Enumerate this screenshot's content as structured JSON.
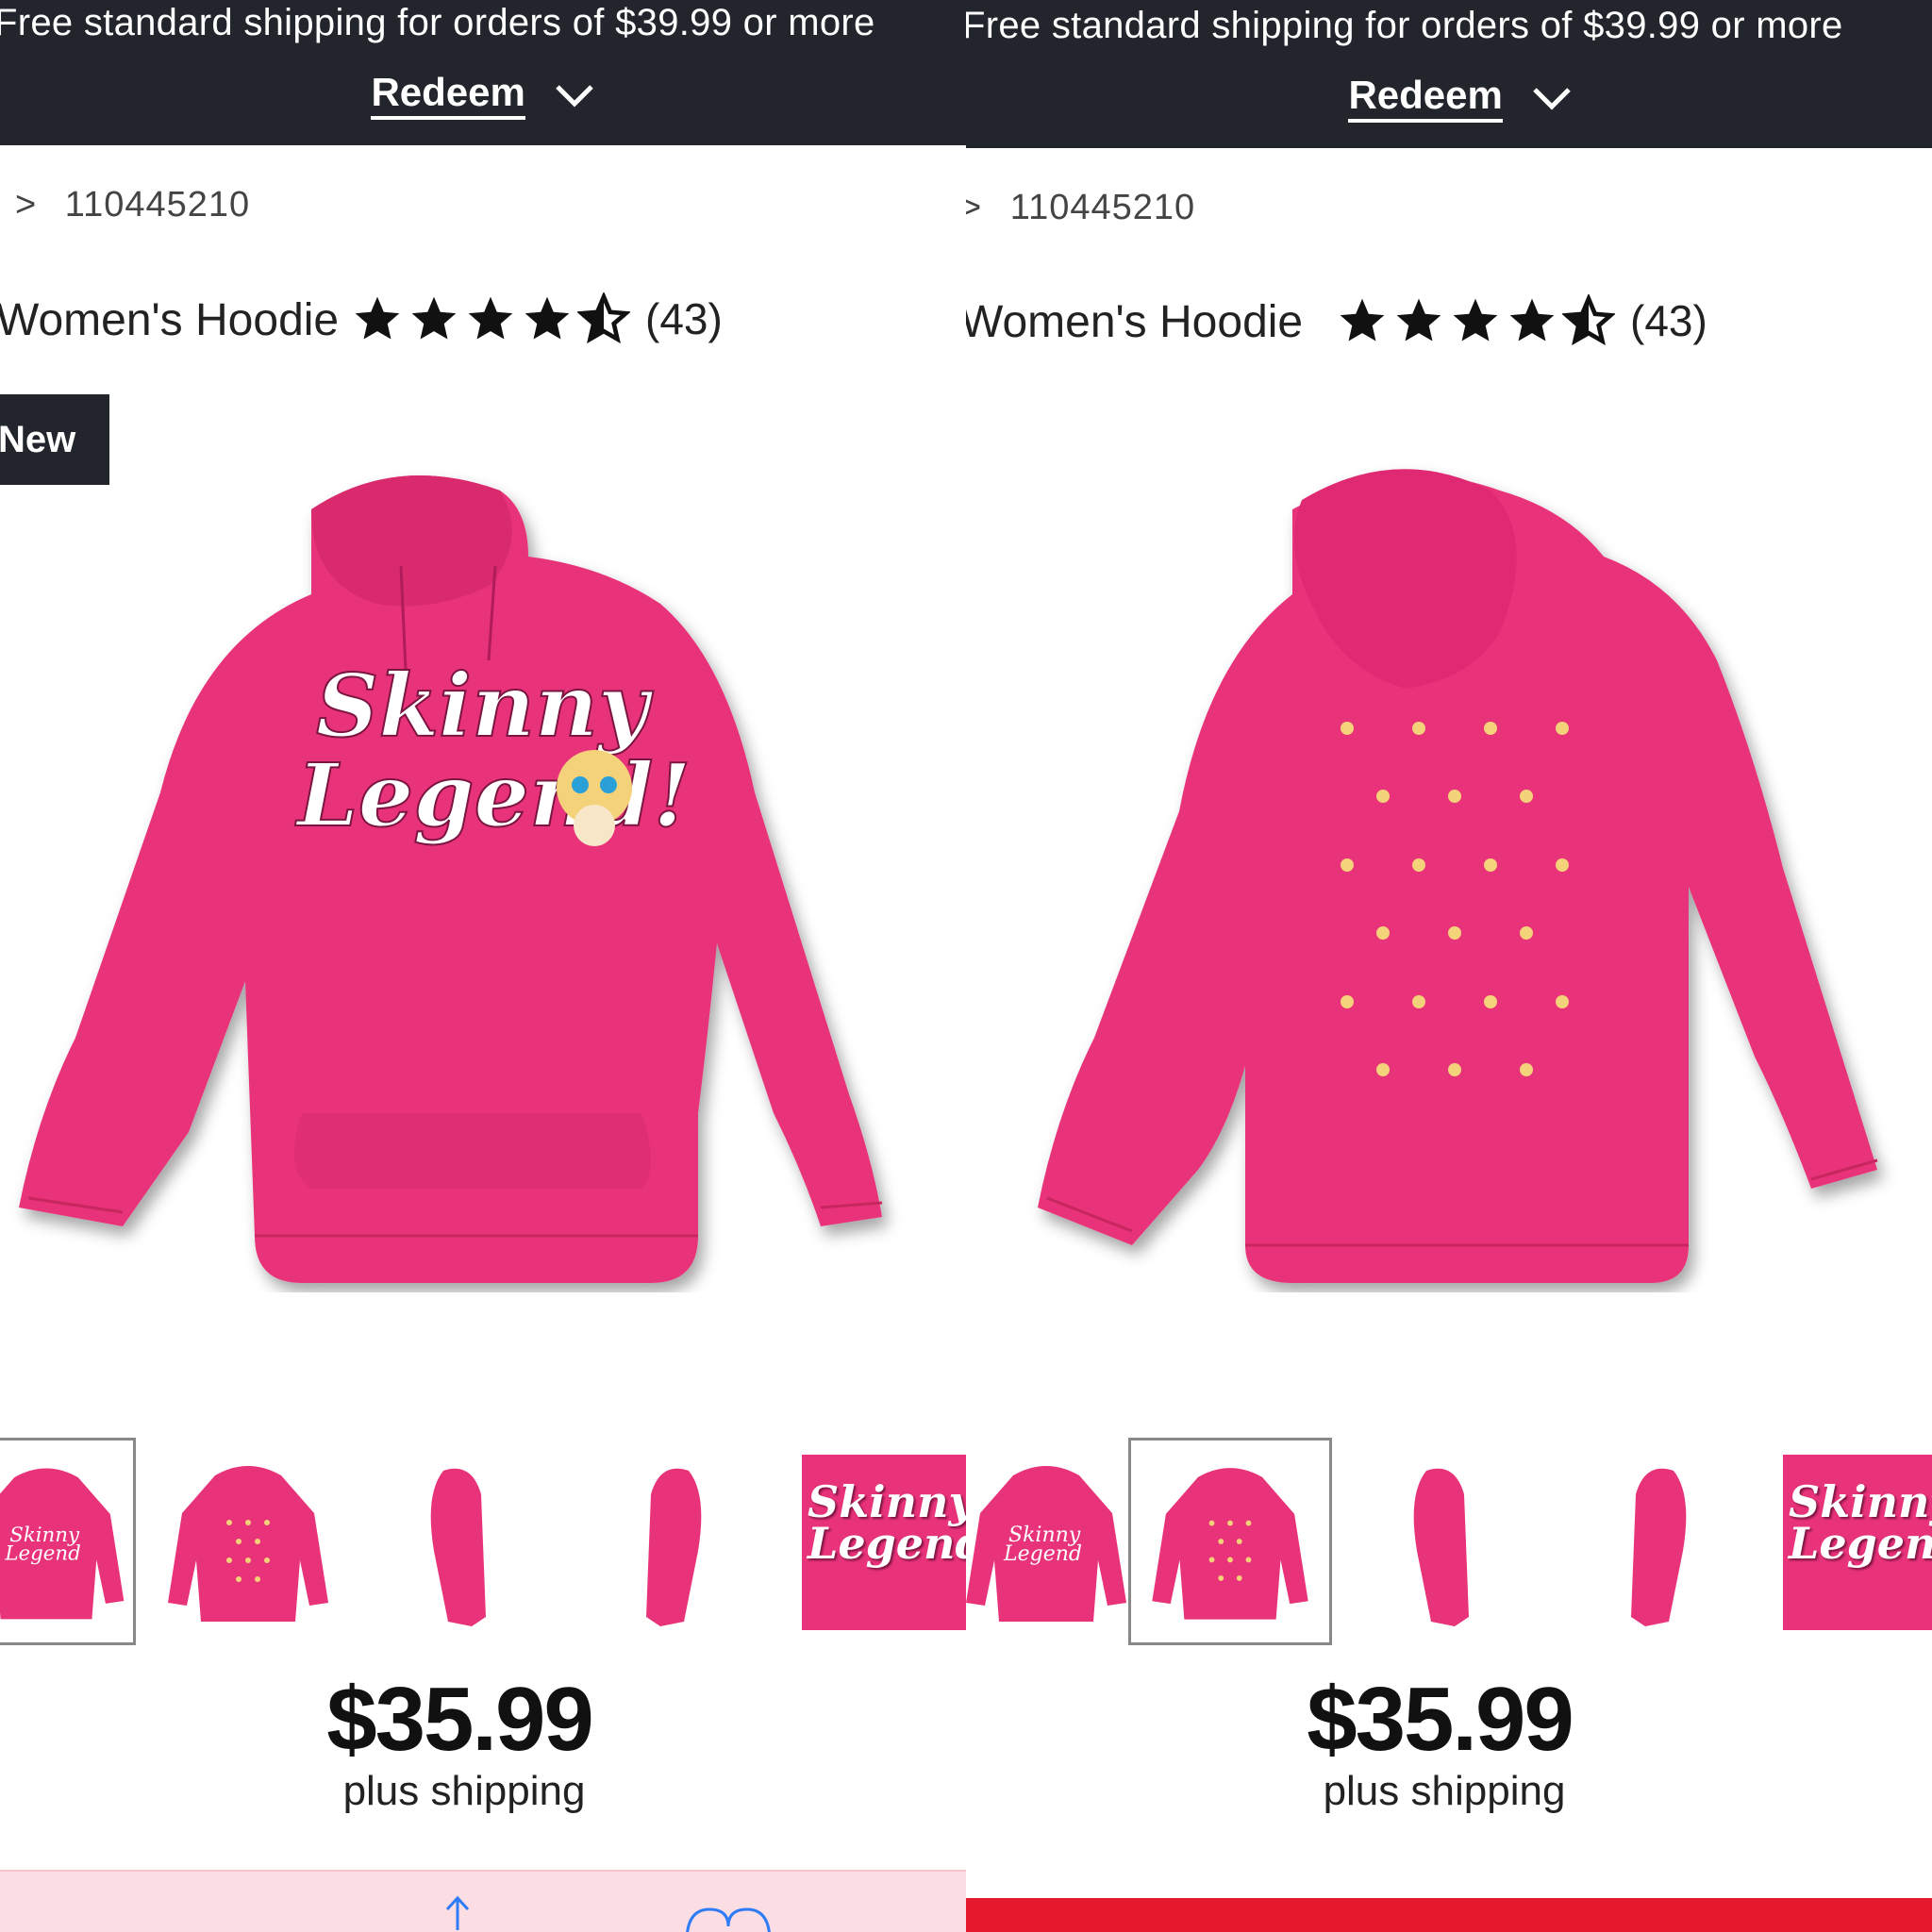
{
  "screens": [
    {
      "promo": {
        "text": "Free standard shipping for orders of $39.99 or more",
        "redeem_label": "Redeem"
      },
      "breadcrumb": {
        "prefix": ">",
        "item": "110445210"
      },
      "product": {
        "title": "Women's Hoodie",
        "rating": 4.5,
        "review_count": "(43)"
      },
      "badge": "New",
      "main_image": "hoodie-front",
      "thumbnails": [
        {
          "view": "front",
          "selected": true
        },
        {
          "view": "back",
          "selected": false
        },
        {
          "view": "side-right",
          "selected": false
        },
        {
          "view": "side-left",
          "selected": false
        },
        {
          "view": "design",
          "selected": false,
          "text": "Skinny Legend!"
        }
      ],
      "design_text": "Skinny Legend!",
      "price": "$35.99",
      "price_note": "plus shipping"
    },
    {
      "promo": {
        "text": "Free standard shipping for orders of $39.99 or more",
        "redeem_label": "Redeem"
      },
      "breadcrumb": {
        "prefix": "> ",
        "item": "110445210"
      },
      "product": {
        "title": "Women's Hoodie",
        "rating": 4.5,
        "review_count": "(43)"
      },
      "main_image": "hoodie-back",
      "thumbnails": [
        {
          "view": "front",
          "selected": false
        },
        {
          "view": "back",
          "selected": true
        },
        {
          "view": "side-right",
          "selected": false
        },
        {
          "view": "side-left",
          "selected": false
        },
        {
          "view": "design",
          "selected": false,
          "text": "Skinny Legend!"
        }
      ],
      "price": "$35.99",
      "price_note": "plus shipping"
    }
  ],
  "colors": {
    "promo_bg": "#22262c",
    "hoodie": "#e8327a",
    "cta_red": "#e5192d",
    "toolbar_pink": "#fbdde4"
  }
}
